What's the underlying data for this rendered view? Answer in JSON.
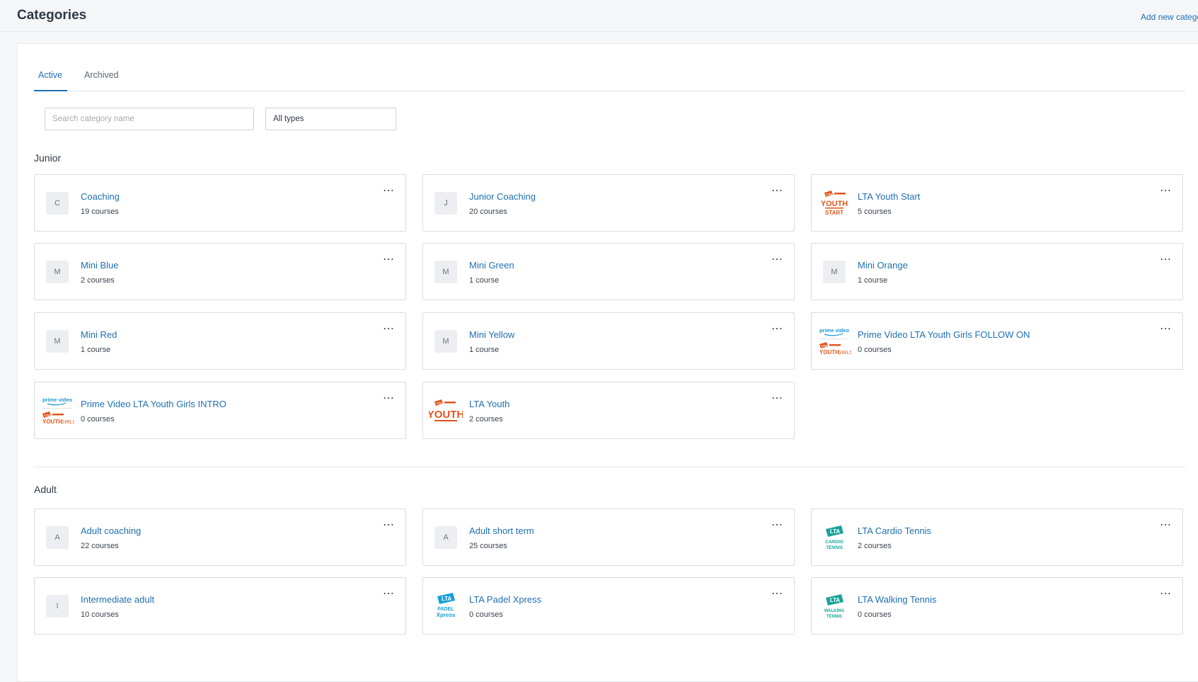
{
  "header": {
    "title": "Categories",
    "add_link": "Add new catego"
  },
  "tabs": [
    {
      "label": "Active",
      "active": true
    },
    {
      "label": "Archived",
      "active": false
    }
  ],
  "filters": {
    "search_placeholder": "Search category name",
    "search_value": "",
    "type_selected": "All types"
  },
  "groups": [
    {
      "label": "Junior",
      "cards": [
        {
          "name": "Coaching",
          "count": "19 courses",
          "initial": "C",
          "icon": "initial-avatar"
        },
        {
          "name": "Junior Coaching",
          "count": "20 courses",
          "initial": "J",
          "icon": "initial-avatar"
        },
        {
          "name": "LTA Youth Start",
          "count": "5 courses",
          "icon": "lta-youth-start-logo"
        },
        {
          "name": "Mini Blue",
          "count": "2 courses",
          "initial": "M",
          "icon": "initial-avatar"
        },
        {
          "name": "Mini Green",
          "count": "1 course",
          "initial": "M",
          "icon": "initial-avatar"
        },
        {
          "name": "Mini Orange",
          "count": "1 course",
          "initial": "M",
          "icon": "initial-avatar"
        },
        {
          "name": "Mini Red",
          "count": "1 course",
          "initial": "M",
          "icon": "initial-avatar"
        },
        {
          "name": "Mini Yellow",
          "count": "1 course",
          "initial": "M",
          "icon": "initial-avatar"
        },
        {
          "name": "Prime Video LTA Youth Girls FOLLOW ON",
          "count": "0 courses",
          "icon": "prime-video-youth-girls-logo"
        },
        {
          "name": "Prime Video LTA Youth Girls INTRO",
          "count": "0 courses",
          "icon": "prime-video-youth-girls-logo"
        },
        {
          "name": "LTA Youth",
          "count": "2 courses",
          "icon": "lta-youth-logo"
        }
      ]
    },
    {
      "label": "Adult",
      "cards": [
        {
          "name": "Adult coaching",
          "count": "22 courses",
          "initial": "A",
          "icon": "initial-avatar"
        },
        {
          "name": "Adult short term",
          "count": "25 courses",
          "initial": "A",
          "icon": "initial-avatar"
        },
        {
          "name": "LTA Cardio Tennis",
          "count": "2 courses",
          "icon": "lta-cardio-tennis-logo"
        },
        {
          "name": "Intermediate adult",
          "count": "10 courses",
          "initial": "I",
          "icon": "initial-avatar"
        },
        {
          "name": "LTA Padel Xpress",
          "count": "0 courses",
          "icon": "lta-padel-xpress-logo"
        },
        {
          "name": "LTA Walking Tennis",
          "count": "0 courses",
          "icon": "lta-walking-tennis-logo"
        }
      ]
    }
  ],
  "logo_text": {
    "youth": "YOUTH",
    "start": "START",
    "girls": "GIRLS",
    "prime_video": "prime video",
    "lta": "LTA",
    "cardio": "CARDIO",
    "tennis": "TENNIS",
    "padel": "PADEL",
    "xpress": "Xpress",
    "walking": "WALKING"
  },
  "colors": {
    "link": "#1f6fb2",
    "youth_orange": "#e2561d",
    "prime_blue": "#1a98d5",
    "lta_teal": "#1aa39a",
    "padel_blue": "#1aa0d8"
  },
  "more_icon": "ellipsis-icon"
}
